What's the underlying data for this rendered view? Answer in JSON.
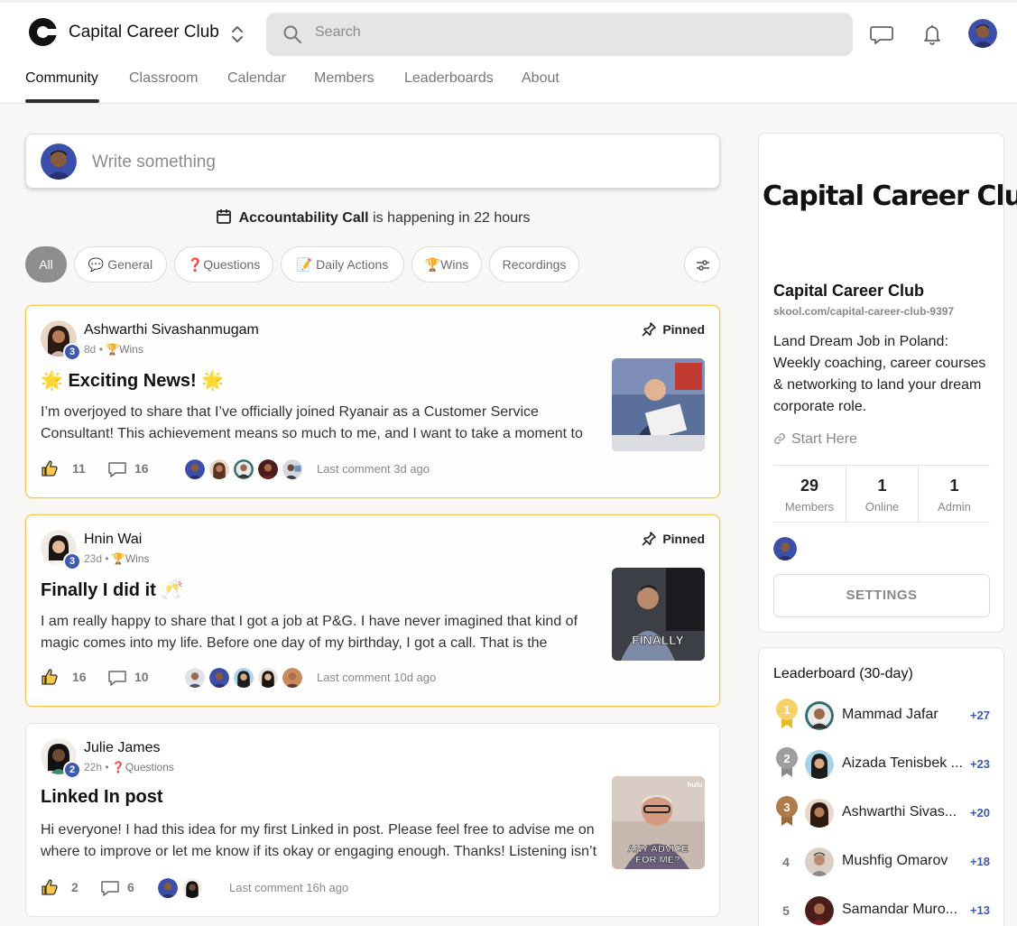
{
  "header": {
    "brand": "Capital Career Club",
    "search_placeholder": "Search"
  },
  "tabs": [
    "Community",
    "Classroom",
    "Calendar",
    "Members",
    "Leaderboards",
    "About"
  ],
  "composer": {
    "placeholder": "Write something"
  },
  "event": {
    "name": "Accountability Call",
    "text": "is happening in 22 hours"
  },
  "filters": [
    "All",
    "💬 General",
    "❓Questions",
    "📝 Daily Actions",
    "🏆Wins",
    "Recordings"
  ],
  "posts": [
    {
      "author": "Ashwarthi Sivashanmugam",
      "level": "3",
      "age": "8d",
      "category": "🏆Wins",
      "pinned_label": "Pinned",
      "title": "🌟 Exciting News! 🌟",
      "body": "I’m overjoyed to share that I’ve officially joined Ryanair as a Customer Service Consultant! This achievement means so much to me, and I want to take a moment to",
      "likes": "11",
      "comments": "16",
      "last_comment": "Last comment 3d ago"
    },
    {
      "author": "Hnin Wai",
      "level": "3",
      "age": "23d",
      "category": "🏆Wins",
      "pinned_label": "Pinned",
      "title": "Finally I did it 🥂",
      "body": "I am really happy to share that I got a job at P&G. I have never imagined that kind of magic comes into my life. Before one day of my birthday, I got a call. That is the",
      "likes": "16",
      "comments": "10",
      "last_comment": "Last comment 10d ago",
      "thumb_caption": "FINALLY"
    },
    {
      "author": "Julie James",
      "level": "2",
      "age": "22h",
      "category": "❓Questions",
      "title": "Linked In post",
      "body": "Hi everyone! I had this idea for my first Linked in post. Please feel free to advise me on where to improve or let me know if its okay or engaging enough. Thanks! Listening isn’t",
      "likes": "2",
      "comments": "6",
      "last_comment": "Last comment 16h ago",
      "thumb_caption": "ANY ADVICE FOR ME?",
      "thumb_brand": "hulu"
    }
  ],
  "about": {
    "logo_text": "Capital Career Club",
    "name": "Capital Career Club",
    "url": "skool.com/capital-career-club-9397",
    "description": "Land Dream Job in Poland: Weekly coaching, career courses & networking to land your dream corporate role.",
    "link": "Start Here",
    "stats": [
      {
        "value": "29",
        "label": "Members"
      },
      {
        "value": "1",
        "label": "Online"
      },
      {
        "value": "1",
        "label": "Admin"
      }
    ],
    "settings_label": "SETTINGS"
  },
  "leaderboard": {
    "title": "Leaderboard (30-day)",
    "rows": [
      {
        "rank": "1",
        "name": "Mammad Jafar",
        "points": "+27"
      },
      {
        "rank": "2",
        "name": "Aizada Tenisbek ...",
        "points": "+23"
      },
      {
        "rank": "3",
        "name": "Ashwarthi Sivas...",
        "points": "+20"
      },
      {
        "rank": "4",
        "name": "Mushfig Omarov",
        "points": "+18"
      },
      {
        "rank": "5",
        "name": "Samandar Muro...",
        "points": "+13"
      }
    ]
  }
}
